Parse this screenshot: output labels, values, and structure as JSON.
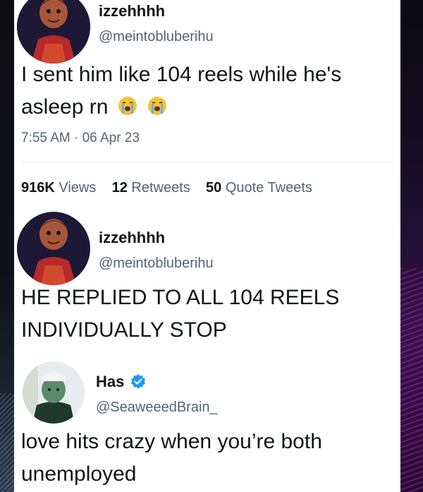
{
  "tweets": [
    {
      "name": "izzehhhh",
      "handle": "@meintobluberihu",
      "text_line1": "I sent him like 104 reels while he's",
      "text_line2": "asleep rn",
      "emojis": [
        "loudly-crying-face-emoji",
        "loudly-crying-face-emoji"
      ],
      "timestamp": "7:55 AM · 06 Apr 23",
      "stats": {
        "views_count": "916K",
        "views_label": "Views",
        "retweets_count": "12",
        "retweets_label": "Retweets",
        "quotes_count": "50",
        "quotes_label": "Quote Tweets"
      }
    },
    {
      "name": "izzehhhh",
      "handle": "@meintobluberihu",
      "text_line1": "HE REPLIED TO ALL 104 REELS",
      "text_line2": "INDIVIDUALLY STOP"
    },
    {
      "name": "Has",
      "verified": true,
      "handle": "@SeaweeedBrain_",
      "text_line1": "love hits crazy when you’re both",
      "text_line2": "unemployed"
    }
  ],
  "colors": {
    "text_primary": "#0f1419",
    "text_secondary": "#536471",
    "verified_blue": "#1d9bf0",
    "background": "#ffffff"
  }
}
